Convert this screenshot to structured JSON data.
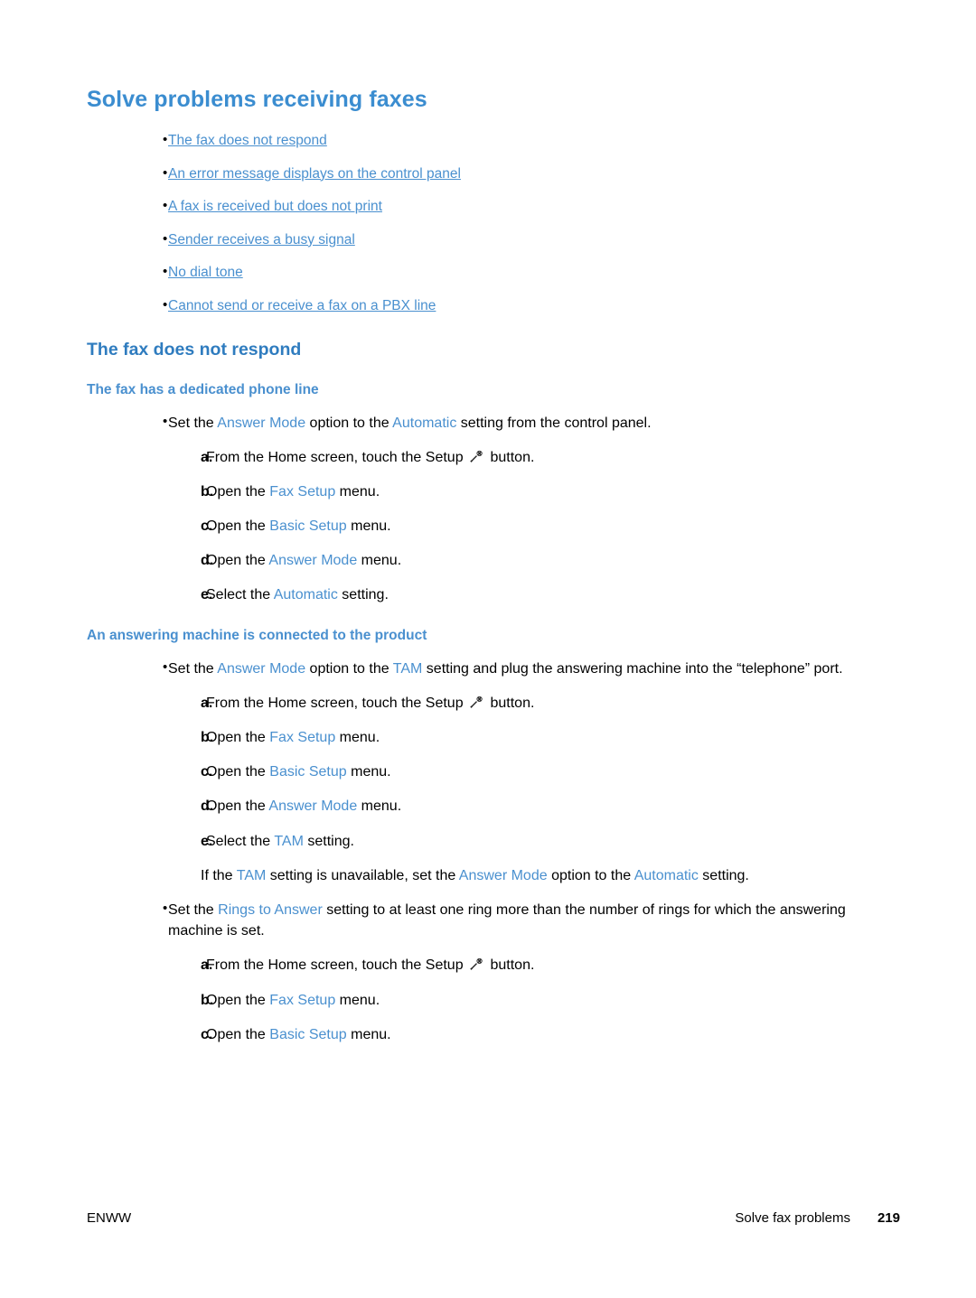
{
  "page": {
    "title": "Solve problems receiving faxes",
    "toc": [
      {
        "label": "The fax does not respond"
      },
      {
        "label": "An error message displays on the control panel"
      },
      {
        "label": "A fax is received but does not print"
      },
      {
        "label": "Sender receives a busy signal"
      },
      {
        "label": "No dial tone"
      },
      {
        "label": "Cannot send or receive a fax on a PBX line"
      }
    ],
    "section_title": "The fax does not respond",
    "sub1": {
      "title": "The fax has a dedicated phone line",
      "bullet": {
        "p1": "Set the ",
        "t1": "Answer Mode",
        "p2": " option to the ",
        "t2": "Automatic",
        "p3": " setting from the control panel."
      },
      "steps": [
        {
          "label": "a.",
          "p1": "From the Home screen, touch the Setup ",
          "t1": "",
          "p2": " button."
        },
        {
          "label": "b.",
          "p1": "Open the ",
          "t1": "Fax Setup",
          "p2": " menu."
        },
        {
          "label": "c.",
          "p1": "Open the ",
          "t1": "Basic Setup",
          "p2": " menu."
        },
        {
          "label": "d.",
          "p1": "Open the ",
          "t1": "Answer Mode",
          "p2": " menu."
        },
        {
          "label": "e.",
          "p1": "Select the ",
          "t1": "Automatic",
          "p2": " setting."
        }
      ]
    },
    "sub2": {
      "title": "An answering machine is connected to the product",
      "bullet1": {
        "p1": "Set the ",
        "t1": "Answer Mode",
        "p2": " option to the ",
        "t2": "TAM",
        "p3": " setting and plug the answering machine into the “telephone” port."
      },
      "steps1": [
        {
          "label": "a.",
          "p1": "From the Home screen, touch the Setup ",
          "t1": "",
          "p2": " button."
        },
        {
          "label": "b.",
          "p1": "Open the ",
          "t1": "Fax Setup",
          "p2": " menu."
        },
        {
          "label": "c.",
          "p1": "Open the ",
          "t1": "Basic Setup",
          "p2": " menu."
        },
        {
          "label": "d.",
          "p1": "Open the ",
          "t1": "Answer Mode",
          "p2": " menu."
        },
        {
          "label": "e.",
          "p1": "Select the ",
          "t1": "TAM",
          "p2": " setting."
        }
      ],
      "note": {
        "p1": "If the ",
        "t1": "TAM",
        "p2": " setting is unavailable, set the ",
        "t2": "Answer Mode",
        "p3": " option to the ",
        "t3": "Automatic",
        "p4": " setting."
      },
      "bullet2": {
        "p1": "Set the ",
        "t1": "Rings to Answer",
        "p2": " setting to at least one ring more than the number of rings for which the answering machine is set."
      },
      "steps2": [
        {
          "label": "a.",
          "p1": "From the Home screen, touch the Setup ",
          "t1": "",
          "p2": " button."
        },
        {
          "label": "b.",
          "p1": "Open the ",
          "t1": "Fax Setup",
          "p2": " menu."
        },
        {
          "label": "c.",
          "p1": "Open the ",
          "t1": "Basic Setup",
          "p2": " menu."
        }
      ]
    },
    "footer": {
      "left": "ENWW",
      "right": "Solve fax problems",
      "page_number": "219"
    },
    "colors": {
      "heading": "#3b8dd0",
      "link": "#4a90cf",
      "section": "#2f7cbf"
    }
  }
}
